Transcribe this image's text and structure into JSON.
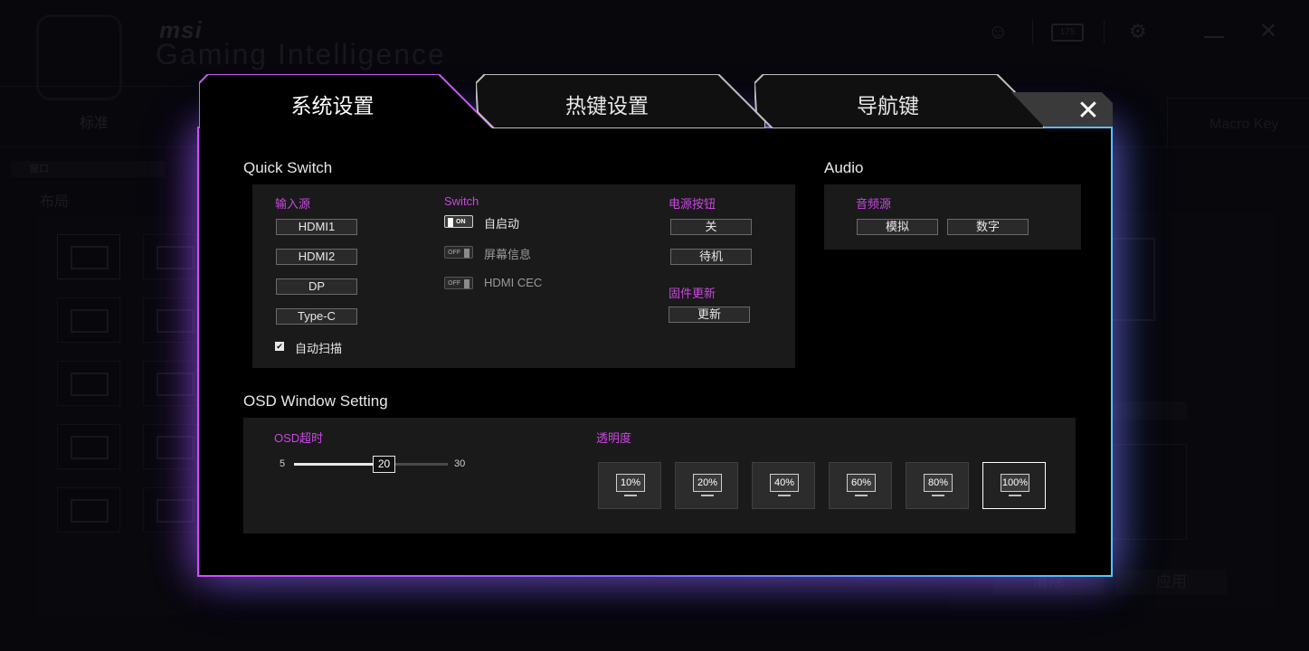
{
  "background": {
    "brand_small": "msi",
    "brand_big": "Gaming Intelligence",
    "hz_badge": "175",
    "tab_standard": "标准",
    "tab_macro": "Macro Key",
    "window_label": "窗口",
    "layout_label": "布局",
    "clear_button": "清除",
    "apply_button": "应用"
  },
  "tabs": [
    {
      "label": "系统设置",
      "active": true
    },
    {
      "label": "热键设置",
      "active": false
    },
    {
      "label": "导航键",
      "active": false
    }
  ],
  "close_glyph": "✕",
  "quick_switch": {
    "title": "Quick Switch",
    "input_source": {
      "label": "输入源",
      "options": [
        "HDMI1",
        "HDMI2",
        "DP",
        "Type-C"
      ],
      "auto_scan_label": "自动扫描",
      "auto_scan_checked": true
    },
    "switch": {
      "label": "Switch",
      "items": [
        {
          "label": "自启动",
          "state": "ON",
          "on": true
        },
        {
          "label": "屏幕信息",
          "state": "OFF",
          "on": false
        },
        {
          "label": "HDMI CEC",
          "state": "OFF",
          "on": false
        }
      ]
    },
    "power_button": {
      "label": "电源按钮",
      "options": [
        "关",
        "待机"
      ]
    },
    "firmware": {
      "label": "固件更新",
      "update_button": "更新"
    }
  },
  "audio": {
    "title": "Audio",
    "source_label": "音频源",
    "options": [
      "模拟",
      "数字"
    ]
  },
  "osd": {
    "title": "OSD Window Setting",
    "timeout_label": "OSD超时",
    "slider_min": "5",
    "slider_max": "30",
    "slider_value": "20",
    "slider_fraction": 0.6,
    "transparency_label": "透明度",
    "transparency_options": [
      "10%",
      "20%",
      "40%",
      "60%",
      "80%",
      "100%"
    ],
    "transparency_selected": "100%"
  },
  "colors": {
    "accent_pink": "#c848e0",
    "border_left": "#d64bff",
    "border_right": "#54c6ff"
  }
}
